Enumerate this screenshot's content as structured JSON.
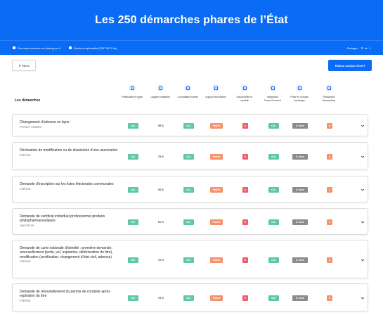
{
  "header": {
    "title": "Les 250 démarches phares de l’État"
  },
  "subbar": {
    "link1": "Données ouvertes sur data.gouv.fr",
    "link2": "Version imprimable (PDF 3217 ko)",
    "share_label": "Partager :",
    "share_icons": [
      "twitter-icon",
      "linkedin-icon",
      "facebook-icon"
    ]
  },
  "toolbar": {
    "filter_label": "▼ Filtres",
    "edition_label": "Édition octobre 2019"
  },
  "table": {
    "title": "Les démarches",
    "columns": [
      {
        "label": "Réalisable en ligne",
        "icon": "cloud-icon"
      },
      {
        "label": "Usagers satisfaits",
        "icon": "smiley-icon"
      },
      {
        "label": "Compatible mobile",
        "icon": "mobile-icon"
      },
      {
        "label": "Support accessible",
        "icon": "support-icon"
      },
      {
        "label": "Disponibilité et rapidité",
        "icon": "speed-icon"
      },
      {
        "label": "Intégration FranceConnect",
        "icon": "user-icon"
      },
      {
        "label": "Prise en compte handicaps",
        "icon": "accessibility-icon"
      },
      {
        "label": "Ressaisies demandées",
        "icon": "briefcase-icon"
      }
    ],
    "rows": [
      {
        "name": "Changement d’adresse en ligne",
        "ministry": "Premier ministre",
        "online": "Oui",
        "satisfaction": "95 %",
        "mobile": "Oui",
        "support": "Partiel",
        "dispo": "9",
        "fc": "Oui",
        "handicap": "À venir",
        "ressaisies": "0"
      },
      {
        "name": "Déclaration de modification ou de dissolution d’une association",
        "ministry": "Intérieur",
        "online": "Oui",
        "satisfaction": "78 %",
        "mobile": "Oui",
        "support": "Partiel",
        "dispo": "9",
        "fc": "Oui",
        "handicap": "À venir",
        "ressaisies": "3"
      },
      {
        "name": "Demande d’inscription sur les listes électorales communales",
        "ministry": "Intérieur",
        "online": "Oui",
        "satisfaction": "93 %",
        "mobile": "Oui",
        "support": "Partiel",
        "dispo": "9",
        "fc": "Oui",
        "handicap": "À venir",
        "ressaisies": "1"
      },
      {
        "name": "Demande de certificat individuel professionnel produits phytopharmaceutiques",
        "ministry": "Agriculture",
        "online": "Oui",
        "satisfaction": "61 %",
        "mobile": "Oui",
        "support": "Partiel",
        "dispo": "9",
        "fc": "Oui",
        "handicap": "À venir",
        "ressaisies": "1"
      },
      {
        "name": "Demande de carte nationale d’identité : première demande, renouvellement (perte, vol, expiration, détérioration du titre), modification (rectification, changement d’état civil, adresse)",
        "ministry": "Intérieur",
        "online": "Oui",
        "satisfaction": "79 %",
        "mobile": "Oui",
        "support": "Partiel",
        "dispo": "9",
        "fc": "Oui",
        "handicap": "À venir",
        "ressaisies": "2"
      },
      {
        "name": "Demande de renouvellement du permis de conduire après expiration du titre",
        "ministry": "Intérieur",
        "online": "Oui",
        "satisfaction": "78 %",
        "mobile": "Oui",
        "support": "Partiel",
        "dispo": "9",
        "fc": "Oui",
        "handicap": "À venir",
        "ressaisies": "2"
      }
    ]
  }
}
